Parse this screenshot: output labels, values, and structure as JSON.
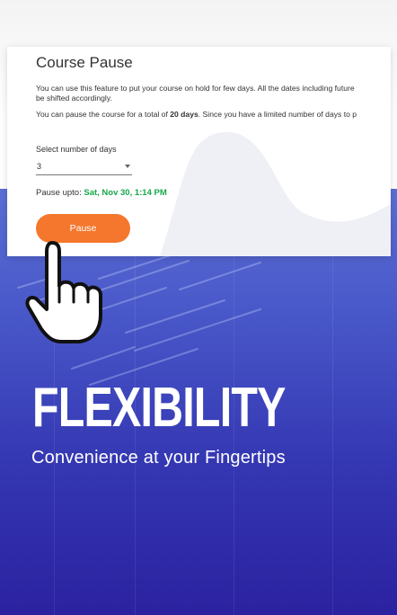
{
  "card": {
    "title": "Course Pause",
    "description_line1": "You can use this feature to put your course on hold for few days. All the dates including future",
    "description_line2": "be shifted accordingly.",
    "limit_prefix": "You can pause the course for a total of ",
    "limit_days": "20 days",
    "limit_suffix": ". Since you have a limited number of days to p",
    "select_label": "Select number of days",
    "select_value": "3",
    "pause_upto_label": "Pause upto: ",
    "pause_upto_date": "Sat, Nov 30, 1:14 PM",
    "pause_button": "Pause"
  },
  "promo": {
    "headline": "FLEXIBILITY",
    "tagline": "Convenience at your Fingertips"
  },
  "colors": {
    "accent_orange": "#f4772d",
    "date_green": "#17a84a",
    "bg_blue_top": "#5b6fd6",
    "bg_blue_bottom": "#2b22a0"
  },
  "icons": {
    "hand": "pointing-hand-icon",
    "dropdown": "caret-down-icon"
  }
}
